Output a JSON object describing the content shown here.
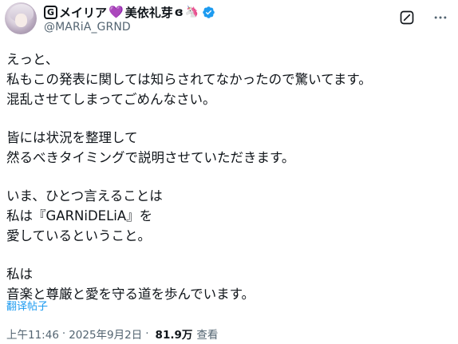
{
  "author": {
    "display_name_prefix_icon": "G",
    "display_name_part1": "メイリア",
    "display_name_heart": "💜",
    "display_name_part2": "美依礼芽",
    "display_name_suffix": "ɞ",
    "display_name_unicorn": "🦄",
    "handle": "@MARiA_GRND",
    "verified_color": "#1d9bf0"
  },
  "tweet": {
    "lines": [
      "えっと、",
      "私もこの発表に関しては知らされてなかったので驚いてます。",
      "混乱させてしまってごめんなさい。",
      "",
      "皆には状況を整理して",
      "然るべきタイミングで説明させていただきます。",
      "",
      "いま、ひとつ言えることは",
      "私は『GARNiDELiA』を",
      "愛しているということ。",
      "",
      "私は",
      "音楽と尊厳と愛を守る道を歩んでいます。"
    ],
    "translate_label": "翻译帖子",
    "time": "上午11:46",
    "separator": "·",
    "date": "2025年9月2日",
    "views": "81.9万",
    "views_label": "查看"
  },
  "icons": {
    "grok": "grok-icon",
    "more": "more-horizontal-icon",
    "verified": "verified-badge-icon"
  },
  "colors": {
    "text": "#0f1419",
    "secondary": "#536471",
    "link": "#1d9bf0",
    "heart": "#a86fd6"
  }
}
